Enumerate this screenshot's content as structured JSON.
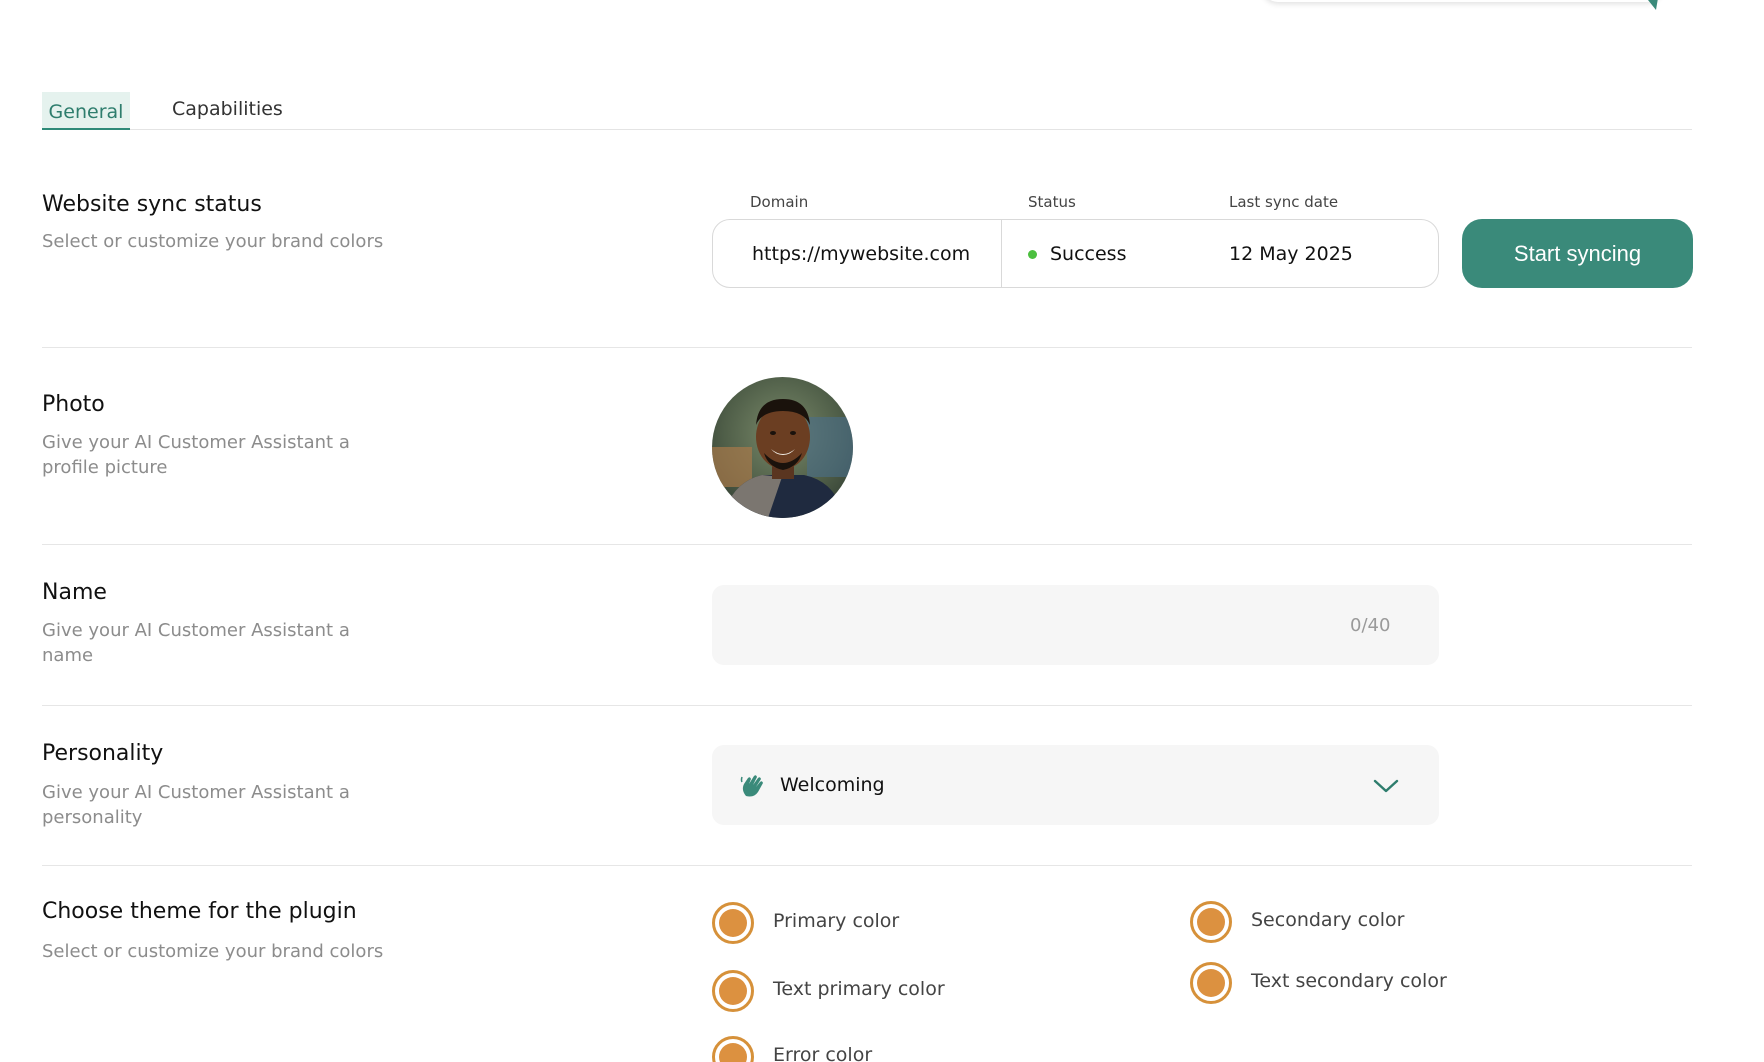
{
  "tabs": [
    {
      "label": "General",
      "active": true
    },
    {
      "label": "Capabilities",
      "active": false
    }
  ],
  "sync": {
    "title": "Website sync status",
    "description": "Select or customize your brand colors",
    "columns": [
      "Domain",
      "Status",
      "Last sync date"
    ],
    "domain": "https://mywebsite.com",
    "status": "Success",
    "status_color": "#4cbf3f",
    "last_sync": "12 May 2025",
    "button_label": "Start syncing"
  },
  "photo": {
    "title": "Photo",
    "description": "Give your AI Customer Assistant a profile picture"
  },
  "name": {
    "title": "Name",
    "description": "Give your AI Customer Assistant a name",
    "value": "",
    "counter": "0/40"
  },
  "personality": {
    "title": "Personality",
    "description": "Give your AI Customer Assistant a personality",
    "selected": "Welcoming",
    "icon": "waving-hand-icon"
  },
  "theme": {
    "title": "Choose theme for the plugin",
    "description": "Select or customize your brand colors",
    "colors": [
      {
        "label": "Primary color",
        "value": "#dc9140"
      },
      {
        "label": "Secondary color",
        "value": "#dc9140"
      },
      {
        "label": "Text primary color",
        "value": "#dc9140"
      },
      {
        "label": "Text secondary color",
        "value": "#dc9140"
      },
      {
        "label": "Error color",
        "value": "#dc9140"
      }
    ]
  },
  "colors": {
    "accent": "#3a8a7a",
    "tab_active_bg": "#e5f2ee",
    "swatch": "#dc9140"
  }
}
